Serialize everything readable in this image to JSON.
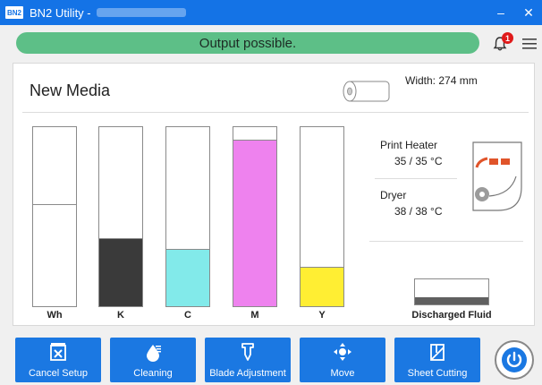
{
  "window": {
    "logo_text": "BN2",
    "title": "BN2 Utility -",
    "minimize_label": "–",
    "close_label": "✕"
  },
  "status": {
    "message": "Output possible.",
    "notification_count": "1"
  },
  "media": {
    "name": "New Media",
    "width_text": "Width: 274 mm"
  },
  "inks": [
    {
      "label": "Wh",
      "level": 0.57,
      "color": "#ffffff"
    },
    {
      "label": "K",
      "level": 0.38,
      "color": "#3a3a3a"
    },
    {
      "label": "C",
      "level": 0.32,
      "color": "#82eaea"
    },
    {
      "label": "M",
      "level": 0.93,
      "color": "#ee82ee"
    },
    {
      "label": "Y",
      "level": 0.22,
      "color": "#ffee33"
    }
  ],
  "heaters": {
    "print_heater_label": "Print Heater",
    "print_heater_value": "35 / 35 °C",
    "dryer_label": "Dryer",
    "dryer_value": "38 / 38 °C"
  },
  "discharged_fluid": {
    "label": "Discharged Fluid",
    "level": 0.3
  },
  "toolbar": {
    "cancel_setup": "Cancel Setup",
    "cleaning": "Cleaning",
    "blade_adjustment": "Blade Adjustment",
    "move": "Move",
    "sheet_cutting": "Sheet Cutting"
  },
  "colors": {
    "accent": "#1473e6",
    "status_ok": "#5dbf87",
    "badge": "#e01a1a"
  }
}
